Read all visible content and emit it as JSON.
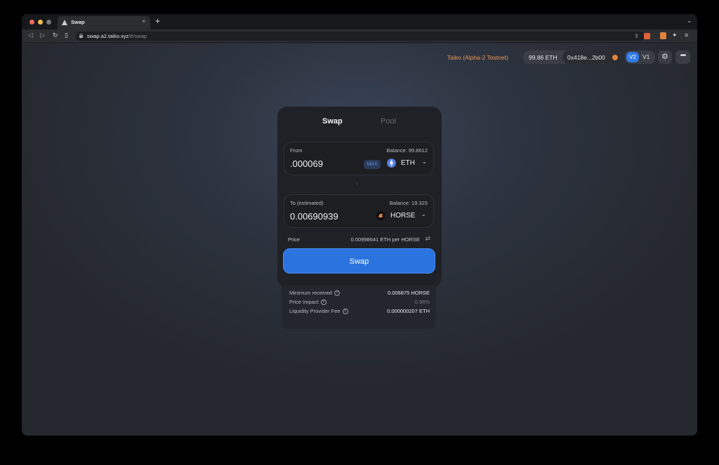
{
  "browser": {
    "tab_title": "Swap",
    "tab_close": "×",
    "new_tab": "+",
    "tab_menu": "⌄",
    "url_host": "swap.a2.taiko.xyz",
    "url_path": "/#/swap",
    "back_icon": "◁",
    "forward_icon": "▷",
    "reload_icon": "↻",
    "bookmark_icon": "▯",
    "share_icon": "⇪",
    "extensions_icon": "✦",
    "menu_icon": "≡"
  },
  "header": {
    "network": "Taiko (Alpha-2 Testnet)",
    "eth_balance": "99.86 ETH",
    "address": "0x418e...2b00",
    "v2_label": "V2",
    "v1_label": "V1",
    "settings_icon": "⚙",
    "more_icon": "•••"
  },
  "card": {
    "tabs": {
      "swap": "Swap",
      "pool": "Pool"
    },
    "from": {
      "label": "From",
      "balance": "Balance: 99.8612",
      "amount": ".000069",
      "max_label": "MAX",
      "token": "ETH",
      "chevron": "⌄"
    },
    "arrow": "↓",
    "to": {
      "label": "To (estimated)",
      "balance": "Balance: 19.325",
      "amount": "0.00690939",
      "token": "HORSE",
      "chevron": "⌄"
    },
    "price": {
      "label": "Price",
      "value": "0.00998641 ETH per HORSE",
      "switch_icon": "⇄"
    },
    "swap_button": "Swap"
  },
  "details": {
    "help_icon": "?",
    "rows": [
      {
        "label": "Minimum received",
        "value": "0.006875 HORSE"
      },
      {
        "label": "Price Impact",
        "value": "0.98%"
      },
      {
        "label": "Liquidity Provider Fee",
        "value": "0.000000207 ETH"
      }
    ]
  },
  "colors": {
    "accent": "#2b74e0",
    "network": "#e8975a",
    "background": "#26292f"
  }
}
